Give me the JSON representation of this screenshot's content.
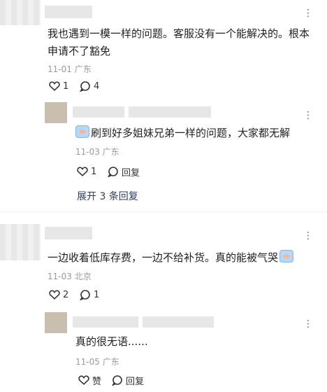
{
  "comments": [
    {
      "text": "我也遇到一模一样的问题。客服没有一个能解决的。根本申请不了豁免",
      "date": "11-01",
      "location": "广东",
      "like_count": "1",
      "reply_count": "4",
      "replies": [
        {
          "text": "刷到好多姐妹兄弟一样的问题，大家都无解",
          "date": "11-03",
          "location": "广东",
          "like_count": "1",
          "reply_label": "回复"
        }
      ],
      "expand_label": "展开 3 条回复"
    },
    {
      "text": "一边收着低库存费，一边不给补货。真的能被气哭",
      "date": "11-03",
      "location": "北京",
      "like_count": "2",
      "reply_count": "1",
      "replies": [
        {
          "text": "真的很无语......",
          "date": "11-05",
          "location": "广东",
          "like_label": "赞",
          "reply_label": "回复"
        }
      ]
    }
  ],
  "more_label": "⋮",
  "icons": {
    "like": "heart-outline-icon",
    "comment": "comment-bubble-icon",
    "emoji": "crying-face-emoji-icon"
  }
}
